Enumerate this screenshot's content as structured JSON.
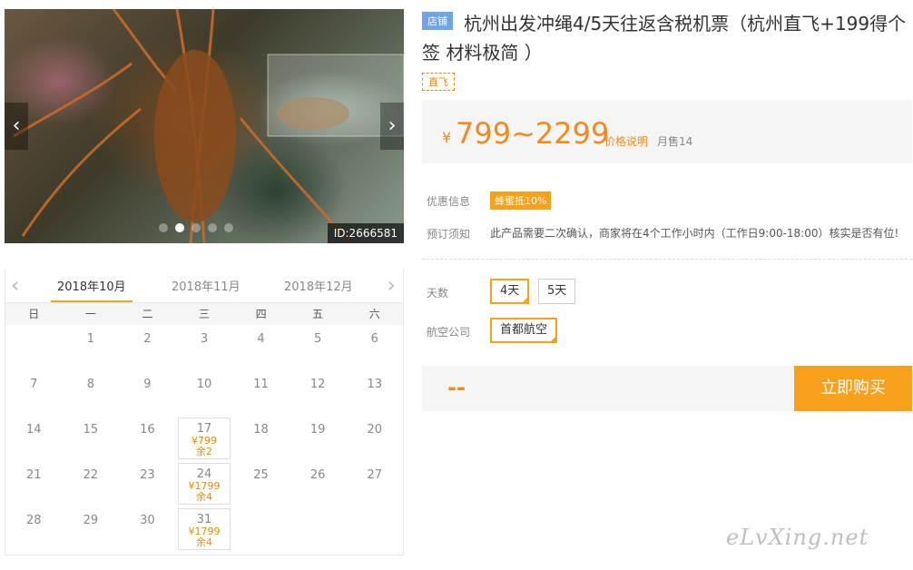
{
  "gallery": {
    "image_id": "ID:2666581",
    "prev_glyph": "‹",
    "next_glyph": "›",
    "dot_count": 5,
    "active_dot": 1
  },
  "calendar": {
    "prev_glyph": "‹",
    "next_glyph": "›",
    "months": [
      "2018年10月",
      "2018年11月",
      "2018年12月"
    ],
    "weekdays": [
      "日",
      "一",
      "二",
      "三",
      "四",
      "五",
      "六"
    ],
    "days": [
      {
        "d": ""
      },
      {
        "d": "1"
      },
      {
        "d": "2"
      },
      {
        "d": "3"
      },
      {
        "d": "4"
      },
      {
        "d": "5"
      },
      {
        "d": "6"
      },
      {
        "d": "7"
      },
      {
        "d": "8"
      },
      {
        "d": "9"
      },
      {
        "d": "10"
      },
      {
        "d": "11"
      },
      {
        "d": "12"
      },
      {
        "d": "13"
      },
      {
        "d": "14"
      },
      {
        "d": "15"
      },
      {
        "d": "16"
      },
      {
        "d": "17",
        "price": "¥799",
        "left": "余2"
      },
      {
        "d": "18"
      },
      {
        "d": "19"
      },
      {
        "d": "20"
      },
      {
        "d": "21"
      },
      {
        "d": "22"
      },
      {
        "d": "23"
      },
      {
        "d": "24",
        "price": "¥1799",
        "left": "余4"
      },
      {
        "d": "25"
      },
      {
        "d": "26"
      },
      {
        "d": "27"
      },
      {
        "d": "28"
      },
      {
        "d": "29"
      },
      {
        "d": "30"
      },
      {
        "d": "31",
        "price": "¥1799",
        "left": "余4"
      },
      {
        "d": ""
      },
      {
        "d": ""
      },
      {
        "d": ""
      }
    ]
  },
  "product": {
    "shop_badge": "店铺",
    "title": "杭州出发冲绳4/5天往返含税机票（杭州直飞+199得个签 材料极简 ）",
    "tag": "直飞",
    "currency": "¥",
    "price_range": "799~2299",
    "price_note": "价格说明",
    "monthly_sales": "月售14"
  },
  "info": {
    "promo_label": "优惠信息",
    "promo_badge": "蜂蜜抵10%",
    "notice_label": "预订须知",
    "notice_text": "此产品需要二次确认，商家将在4个工作小时内（工作日9:00-18:00）核实是否有位!"
  },
  "options": {
    "days_label": "天数",
    "days": [
      "4天",
      "5天"
    ],
    "airline_label": "航空公司",
    "airline": "首都航空"
  },
  "purchase": {
    "total": "--",
    "buy_label": "立即购买"
  },
  "watermark": "eLvXing.net",
  "colors": {
    "accent": "#f9a11b",
    "price": "#f38a1d",
    "shop_badge": "#6fa5e8"
  }
}
